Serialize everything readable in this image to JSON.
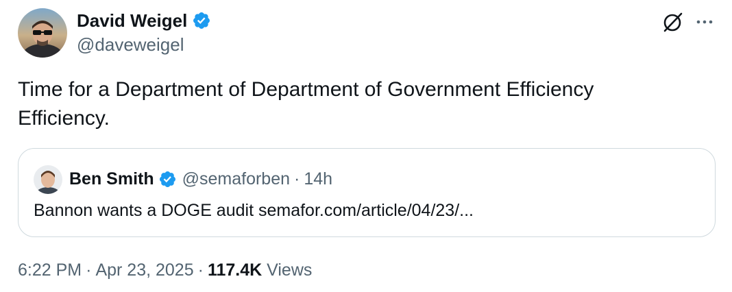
{
  "author": {
    "display_name": "David Weigel",
    "handle": "@daveweigel",
    "verified": true
  },
  "tweet": {
    "text": "Time for a Department of Department of Government Efficiency Efficiency."
  },
  "quoted_tweet": {
    "display_name": "Ben Smith",
    "handle": "@semaforben",
    "separator": "·",
    "time_ago": "14h",
    "text": "Bannon wants a DOGE audit semafor.com/article/04/23/..."
  },
  "meta": {
    "time": "6:22 PM",
    "separator": "·",
    "date": "Apr 23, 2025",
    "views_count": "117.4K",
    "views_label": "Views"
  },
  "icons": {
    "verified": "verified-badge-icon",
    "grok": "grok-icon",
    "more": "more-options-icon"
  },
  "colors": {
    "verified_blue": "#1d9bf0",
    "secondary_text": "#536471",
    "primary_text": "#0f1419",
    "border": "#cfd9de"
  }
}
